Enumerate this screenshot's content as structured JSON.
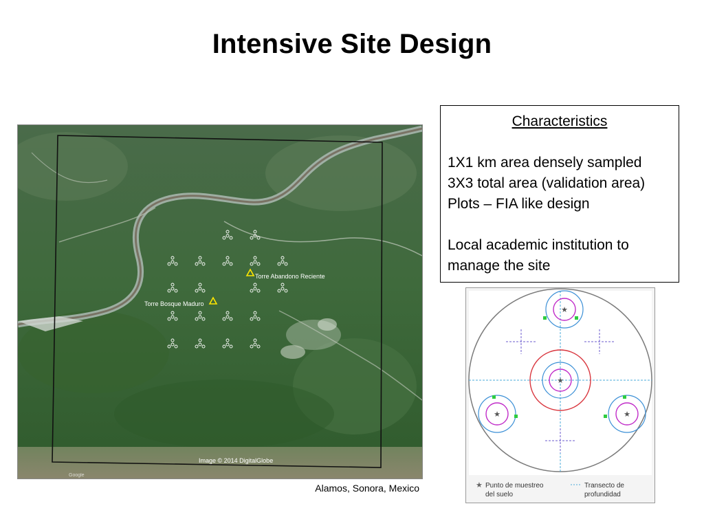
{
  "slide": {
    "title": "Intensive Site Design",
    "caption": "Alamos, Sonora, Mexico"
  },
  "map": {
    "labels": {
      "tower_recent": "Torre Abandono Reciente",
      "tower_mature": "Torre Bosque Maduro",
      "image_credit": "Image © 2014 DigitalGlobe",
      "google": "Google"
    }
  },
  "characteristics": {
    "heading": "Characteristics",
    "lines": [
      "1X1 km area densely sampled",
      "3X3 total area (validation area)",
      "Plots – FIA like design"
    ],
    "note_lines": [
      "Local academic institution to",
      "manage the site"
    ]
  },
  "plot_legend": {
    "soil_point_line1": "Punto de muestreo",
    "soil_point_line2": "del suelo",
    "transect_line1": "Transecto de",
    "transect_line2": "profundidad"
  },
  "colors": {
    "forest": "#3d5e38",
    "river": "#a9b9b0",
    "outer_circle": "#7a7a7a",
    "red_ring": "#d9363e",
    "blue_ring": "#3a8fd6",
    "magenta_ring": "#c02ac8",
    "transect": "#48a9d8",
    "green_marker": "#2ecc40",
    "subplot_marker": "#6a5acd"
  }
}
